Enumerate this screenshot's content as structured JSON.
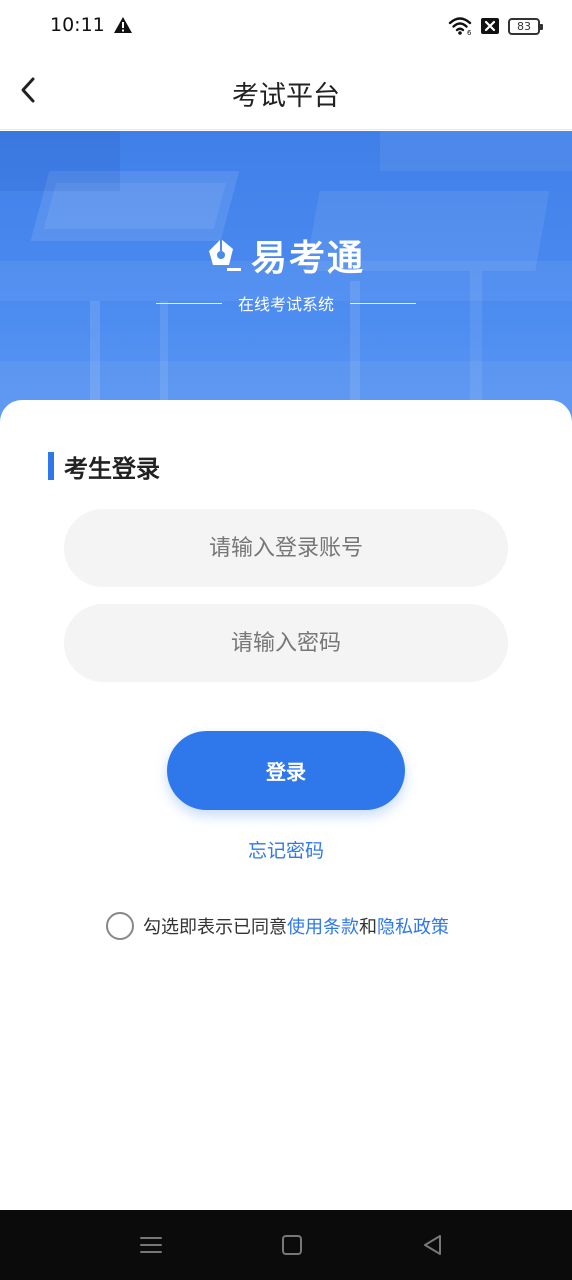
{
  "status_bar": {
    "time": "10:11",
    "battery": "83",
    "icons": [
      "warning-icon",
      "wifi-icon",
      "sim-off-icon",
      "battery-icon"
    ]
  },
  "nav": {
    "title": "考试平台",
    "back_icon": "chevron-left-icon"
  },
  "banner": {
    "brand_name": "易考通",
    "logo_icon": "pen-nib-logo-icon",
    "tagline": "在线考试系统"
  },
  "login": {
    "section_title": "考生登录",
    "account_placeholder": "请输入登录账号",
    "password_placeholder": "请输入密码",
    "login_button": "登录",
    "forgot_password": "忘记密码",
    "agreement_prefix": "勾选即表示已同意",
    "terms_link": "使用条款",
    "agreement_and": "和",
    "privacy_link": "隐私政策",
    "agreement_checked": false
  },
  "system_nav": {
    "icons": [
      "menu-icon",
      "home-icon",
      "back-triangle-icon"
    ]
  },
  "colors": {
    "accent": "#2f78ec",
    "banner": "#4b8bf0",
    "input_bg": "#f4f4f4",
    "system_nav_bg": "#0b0b0b"
  }
}
